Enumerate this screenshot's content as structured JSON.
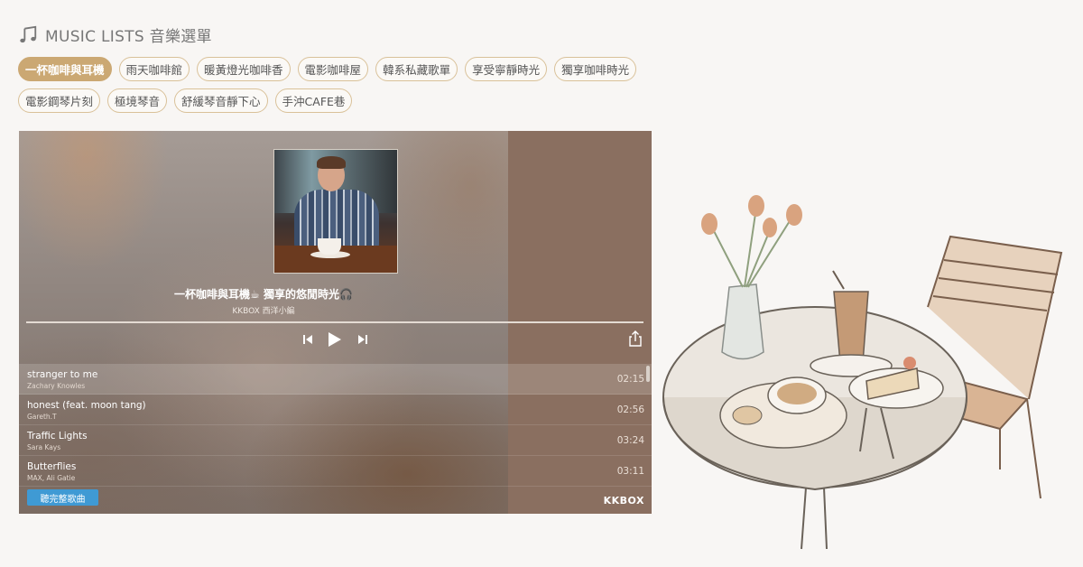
{
  "header": {
    "icon": "music-note-icon",
    "title": "MUSIC LISTS 音樂選單"
  },
  "tags": {
    "row1": [
      "一杯咖啡與耳機",
      "雨天咖啡館",
      "暖黃燈光咖啡香",
      "電影咖啡屋",
      "韓系私藏歌單",
      "享受寧靜時光",
      "獨享咖啡時光"
    ],
    "row2": [
      "電影鋼琴片刻",
      "極境琴音",
      "舒緩琴音靜下心",
      "手沖CAFE巷"
    ],
    "active": "一杯咖啡與耳機"
  },
  "player": {
    "title": "一杯咖啡與耳機☕ 獨享的悠閒時光🎧",
    "curator": "KKBOX 西洋小編",
    "tracks": [
      {
        "name": "stranger to me",
        "artist": "Zachary Knowles",
        "time": "02:15"
      },
      {
        "name": "honest (feat. moon tang)",
        "artist": "Gareth.T",
        "time": "02:56"
      },
      {
        "name": "Traffic Lights",
        "artist": "Sara Kays",
        "time": "03:24"
      },
      {
        "name": "Butterflies",
        "artist": "MAX, Ali Gatie",
        "time": "03:11"
      }
    ],
    "full_button": "聽完整歌曲",
    "brand": "KKBOX",
    "controls": [
      "previous-icon",
      "play-icon",
      "next-icon",
      "share-icon"
    ]
  },
  "colors": {
    "accent": "#cba873",
    "tag_border": "#d9c199",
    "button_blue": "#3f9ad4",
    "panel_brown": "#8a6f60"
  }
}
